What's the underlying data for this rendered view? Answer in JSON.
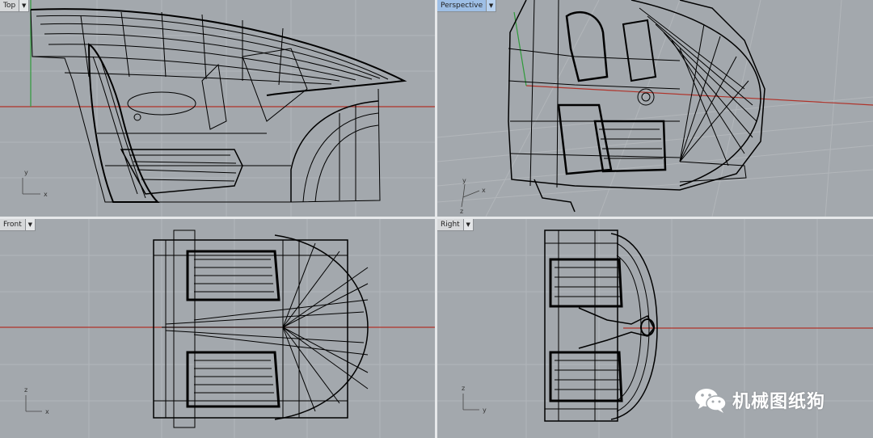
{
  "viewports": {
    "top": {
      "label": "Top",
      "axis_h": "x",
      "axis_v": "y"
    },
    "perspective": {
      "label": "Perspective",
      "axis_h": "x",
      "axis_v": "y",
      "axis_z": "z"
    },
    "front": {
      "label": "Front",
      "axis_h": "x",
      "axis_v": "z"
    },
    "right": {
      "label": "Right",
      "axis_h": "y",
      "axis_v": "z"
    }
  },
  "colors": {
    "viewport_bg": "#a3a8ad",
    "grid": "#b2b6ba",
    "axis_x": "#b0332a",
    "axis_y": "#2f9a3a",
    "wire": "#000000",
    "active_label": "#9ebfe6"
  },
  "watermark": {
    "text": "机械图纸狗",
    "icon": "wechat-icon"
  }
}
